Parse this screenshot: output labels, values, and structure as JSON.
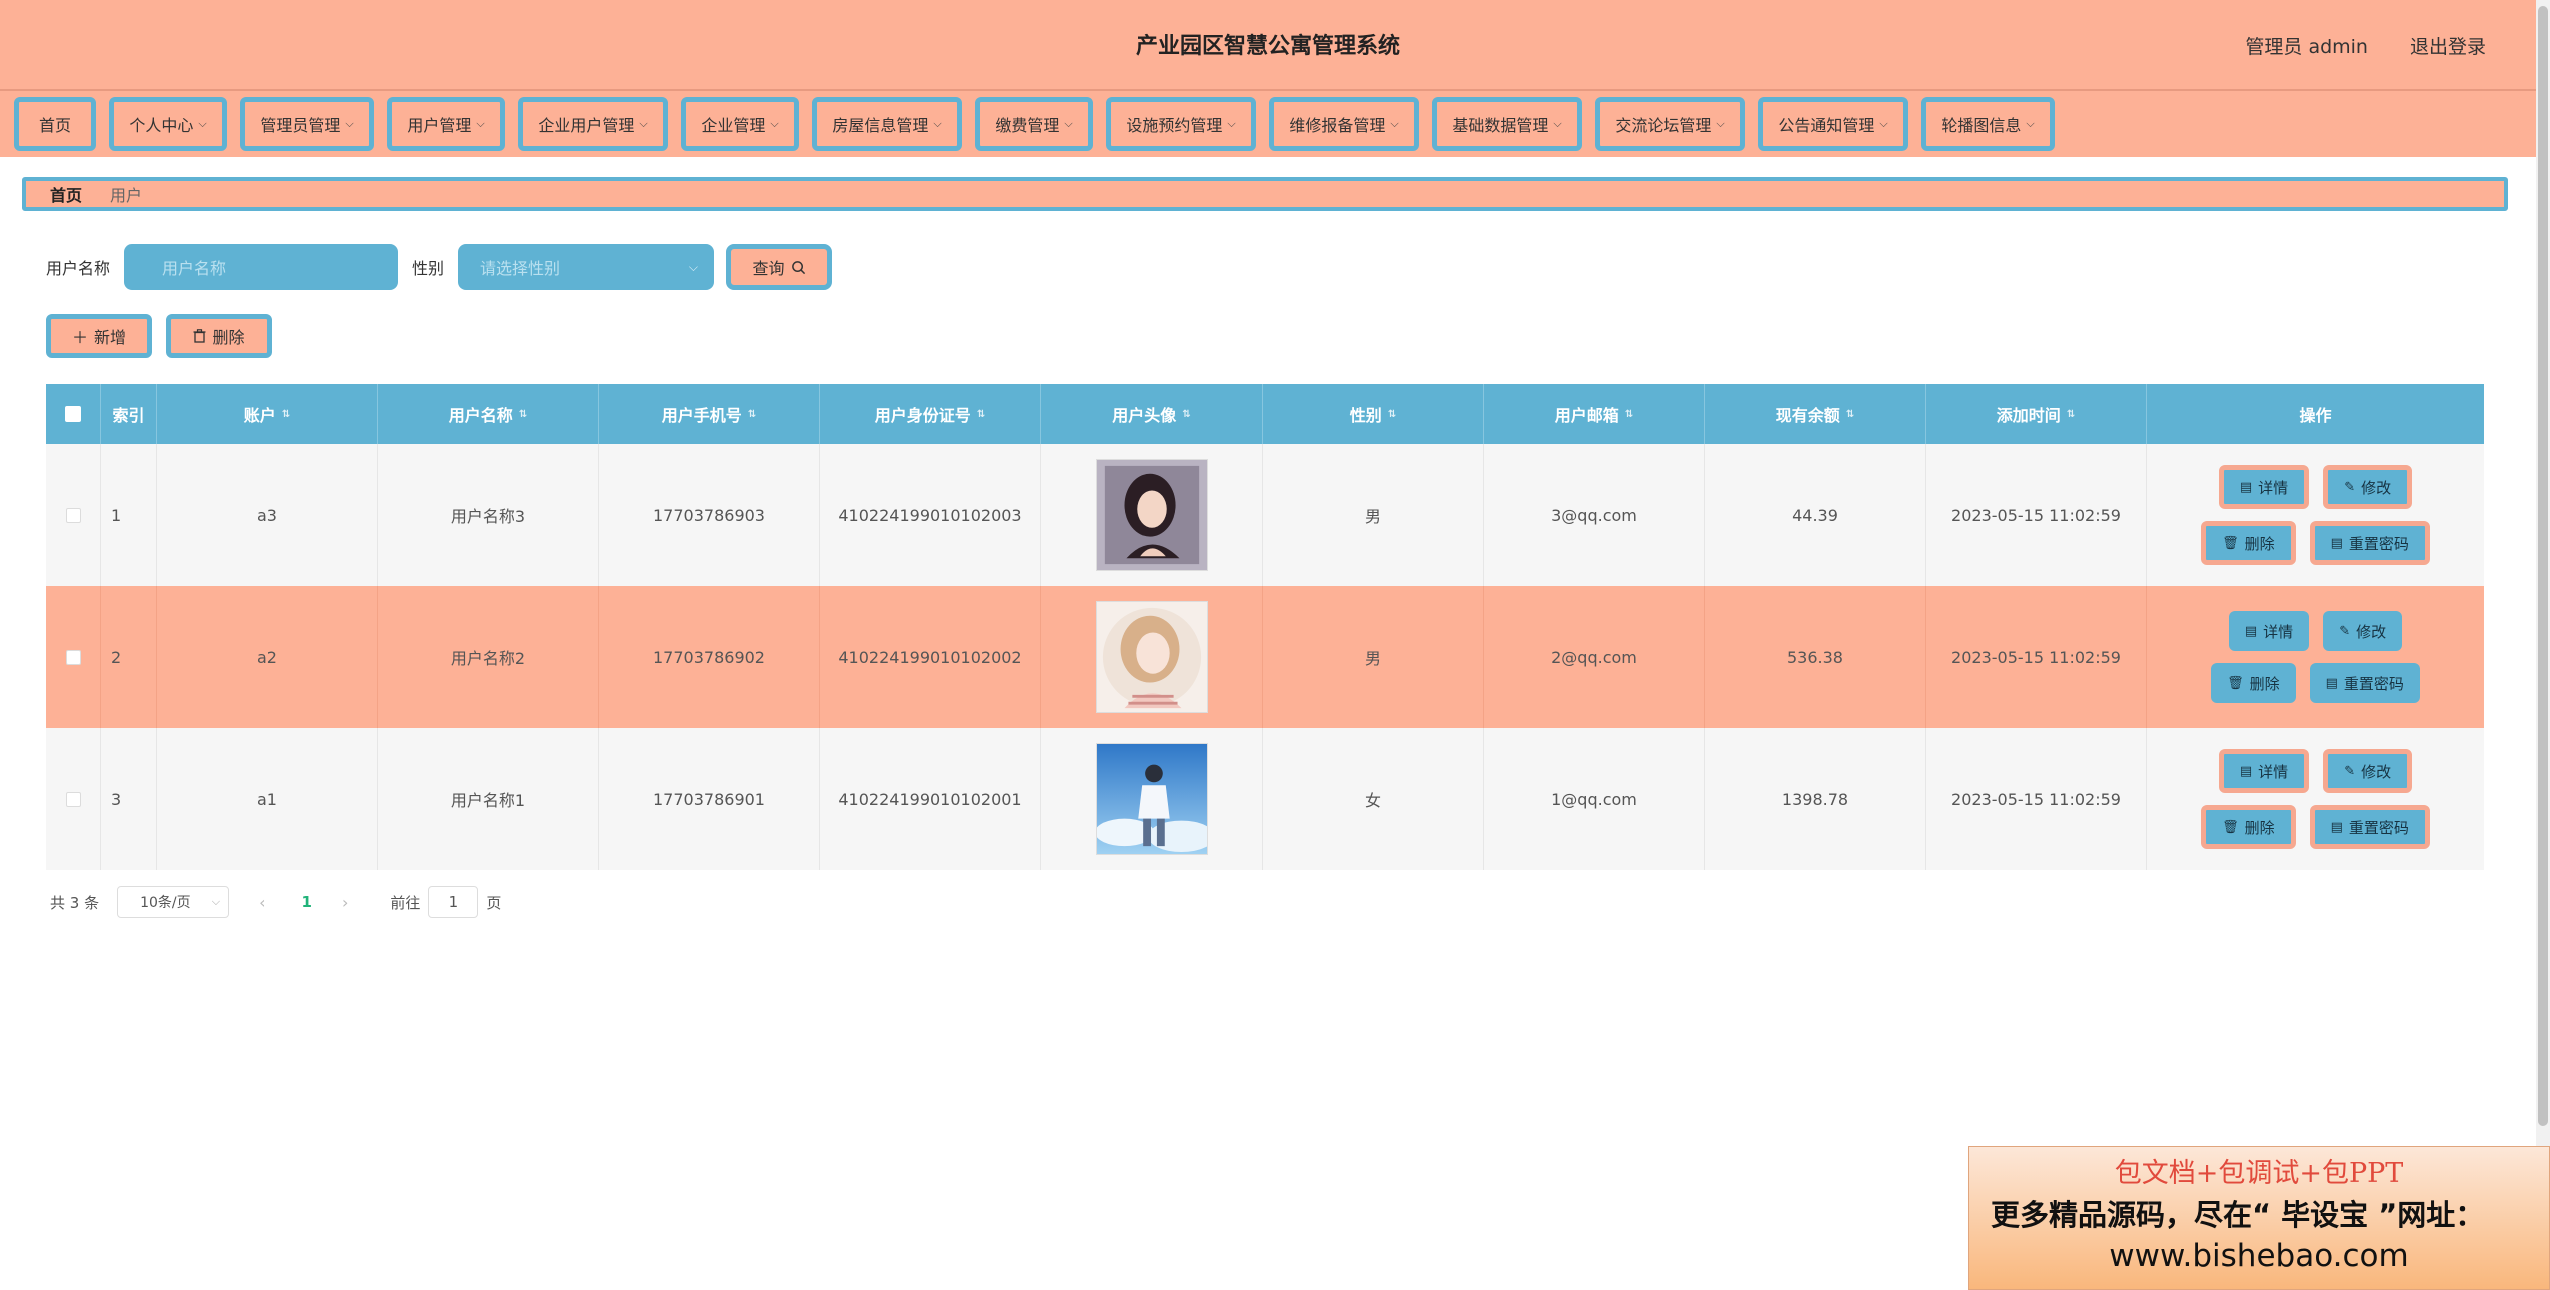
{
  "header": {
    "title": "产业园区智慧公寓管理系统",
    "user_label": "管理员 admin",
    "logout": "退出登录"
  },
  "nav": [
    {
      "label": "首页",
      "dropdown": false
    },
    {
      "label": "个人中心",
      "dropdown": true
    },
    {
      "label": "管理员管理",
      "dropdown": true
    },
    {
      "label": "用户管理",
      "dropdown": true
    },
    {
      "label": "企业用户管理",
      "dropdown": true
    },
    {
      "label": "企业管理",
      "dropdown": true
    },
    {
      "label": "房屋信息管理",
      "dropdown": true
    },
    {
      "label": "缴费管理",
      "dropdown": true
    },
    {
      "label": "设施预约管理",
      "dropdown": true
    },
    {
      "label": "维修报备管理",
      "dropdown": true
    },
    {
      "label": "基础数据管理",
      "dropdown": true
    },
    {
      "label": "交流论坛管理",
      "dropdown": true
    },
    {
      "label": "公告通知管理",
      "dropdown": true
    },
    {
      "label": "轮播图信息",
      "dropdown": true
    }
  ],
  "breadcrumb": {
    "home": "首页",
    "current": "用户"
  },
  "search": {
    "name_label": "用户名称",
    "name_placeholder": "用户名称",
    "gender_label": "性别",
    "gender_placeholder": "请选择性别",
    "query_label": "查询"
  },
  "actions": {
    "add": "新增",
    "delete": "删除"
  },
  "table": {
    "headers": [
      "索引",
      "账户",
      "用户名称",
      "用户手机号",
      "用户身份证号",
      "用户头像",
      "性别",
      "用户邮箱",
      "现有余额",
      "添加时间",
      "操作"
    ],
    "rows": [
      {
        "index": "1",
        "account": "a3",
        "name": "用户名称3",
        "phone": "17703786903",
        "id_card": "410224199010102003",
        "gender": "男",
        "email": "3@qq.com",
        "balance": "44.39",
        "time": "2023-05-15 11:02:59"
      },
      {
        "index": "2",
        "account": "a2",
        "name": "用户名称2",
        "phone": "17703786902",
        "id_card": "410224199010102002",
        "gender": "男",
        "email": "2@qq.com",
        "balance": "536.38",
        "time": "2023-05-15 11:02:59"
      },
      {
        "index": "3",
        "account": "a1",
        "name": "用户名称1",
        "phone": "17703786901",
        "id_card": "410224199010102001",
        "gender": "女",
        "email": "1@qq.com",
        "balance": "1398.78",
        "time": "2023-05-15 11:02:59"
      }
    ],
    "ops": {
      "detail": "详情",
      "edit": "修改",
      "delete": "删除",
      "reset": "重置密码"
    }
  },
  "pager": {
    "total": "共 3 条",
    "size": "10条/页",
    "current": "1",
    "goto": "前往",
    "goto_value": "1",
    "page_unit": "页"
  },
  "ad": {
    "line1": "包文档+包调试+包PPT",
    "line2": "更多精品源码，尽在“ 毕设宝 ”网址：",
    "line3": "www.bishebao.com"
  },
  "colors": {
    "accent_blue": "#5fb2d3",
    "accent_salmon": "#fdb196"
  }
}
